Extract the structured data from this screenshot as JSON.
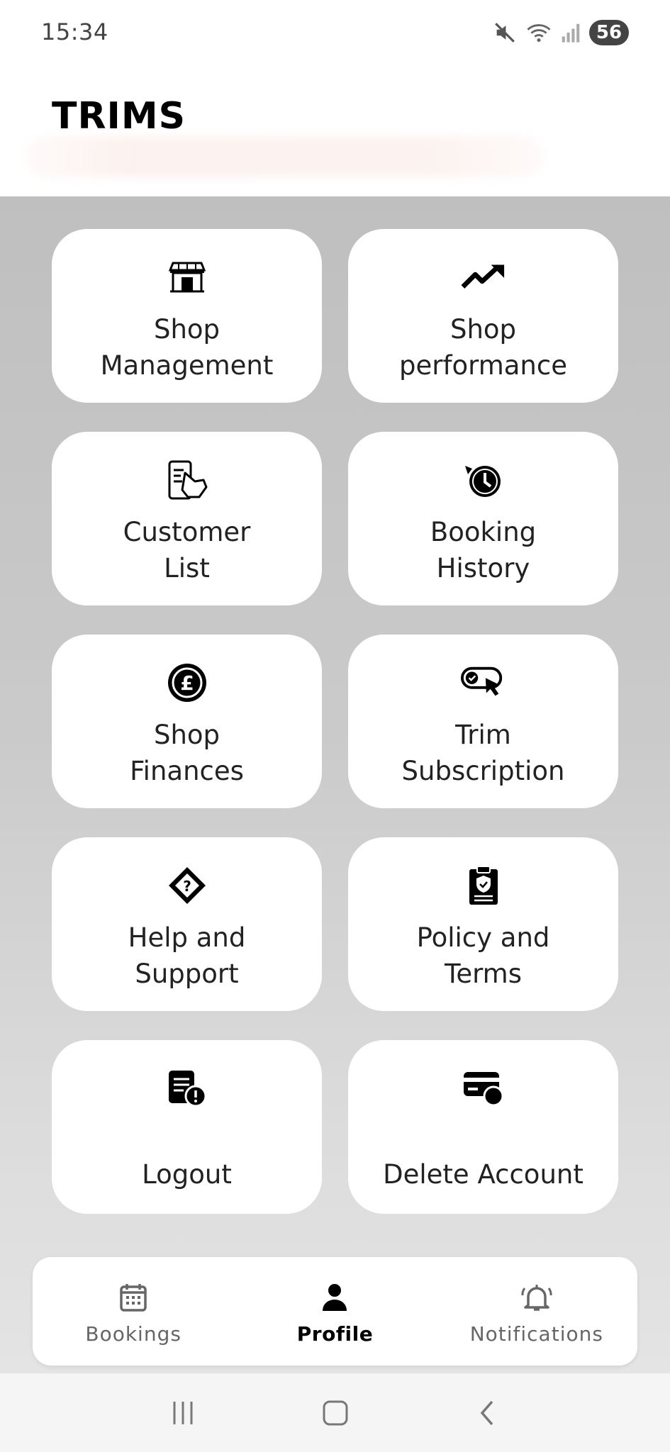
{
  "status_bar": {
    "time": "15:34",
    "battery": "56",
    "icons": [
      "mute-icon",
      "wifi-icon",
      "signal-icon"
    ]
  },
  "header": {
    "title": "TRIMS"
  },
  "menu": {
    "tiles": [
      {
        "line1": "Shop",
        "line2": "Management",
        "icon": "shop-icon"
      },
      {
        "line1": "Shop",
        "line2": "performance",
        "icon": "trending-up-icon"
      },
      {
        "line1": "Customer",
        "line2": "List",
        "icon": "phone-list-icon"
      },
      {
        "line1": "Booking",
        "line2": "History",
        "icon": "history-clock-icon"
      },
      {
        "line1": "Shop",
        "line2": "Finances",
        "icon": "pound-coin-icon"
      },
      {
        "line1": "Trim",
        "line2": "Subscription",
        "icon": "toggle-cursor-icon"
      },
      {
        "line1": "Help and",
        "line2": "Support",
        "icon": "help-diamond-icon"
      },
      {
        "line1": "Policy and",
        "line2": "Terms",
        "icon": "clipboard-shield-icon"
      },
      {
        "label": "Logout",
        "icon": "document-alert-icon"
      },
      {
        "label": "Delete Account",
        "icon": "card-delete-icon"
      }
    ]
  },
  "bottom_nav": {
    "items": [
      {
        "label": "Bookings",
        "icon": "calendar-icon",
        "active": false
      },
      {
        "label": "Profile",
        "icon": "person-icon",
        "active": true
      },
      {
        "label": "Notifications",
        "icon": "bell-icon",
        "active": false
      }
    ]
  },
  "colors": {
    "accent": "#000000",
    "tile_bg": "#ffffff",
    "content_bg_top": "#bfbfbf",
    "content_bg_bottom": "#e4e4e4",
    "inactive_nav": "#666666"
  }
}
